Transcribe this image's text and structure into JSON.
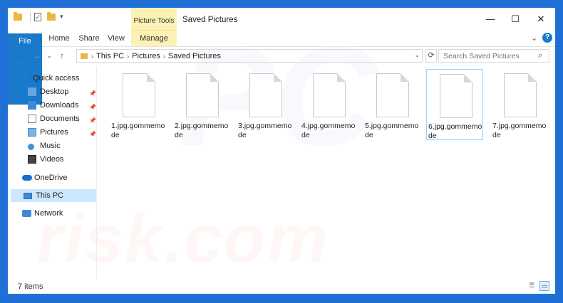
{
  "window": {
    "title": "Saved Pictures",
    "context_group": "Picture Tools"
  },
  "ribbon": {
    "tabs": [
      {
        "label": "File"
      },
      {
        "label": "Home"
      },
      {
        "label": "Share"
      },
      {
        "label": "View"
      },
      {
        "label": "Manage"
      }
    ]
  },
  "address": {
    "crumbs": [
      "This PC",
      "Pictures",
      "Saved Pictures"
    ]
  },
  "search": {
    "placeholder": "Search Saved Pictures"
  },
  "nav": {
    "quick_access": "Quick access",
    "items": [
      {
        "label": "Desktop",
        "pinned": true
      },
      {
        "label": "Downloads",
        "pinned": true
      },
      {
        "label": "Documents",
        "pinned": true
      },
      {
        "label": "Pictures",
        "pinned": true
      },
      {
        "label": "Music",
        "pinned": false
      },
      {
        "label": "Videos",
        "pinned": false
      }
    ],
    "onedrive": "OneDrive",
    "this_pc": "This PC",
    "network": "Network"
  },
  "files": [
    {
      "name": "1.jpg.gommemode"
    },
    {
      "name": "2.jpg.gommemode"
    },
    {
      "name": "3.jpg.gommemode"
    },
    {
      "name": "4.jpg.gommemode"
    },
    {
      "name": "5.jpg.gommemode"
    },
    {
      "name": "6.jpg.gommemode",
      "selected": true
    },
    {
      "name": "7.jpg.gommemode"
    }
  ],
  "status": {
    "count": "7 items"
  },
  "watermark": {
    "text": "risk.com",
    "logo": "PC"
  },
  "colors": {
    "accent": "#1979ca",
    "context_tab": "#fdf2b6",
    "selection": "#cce8ff"
  }
}
